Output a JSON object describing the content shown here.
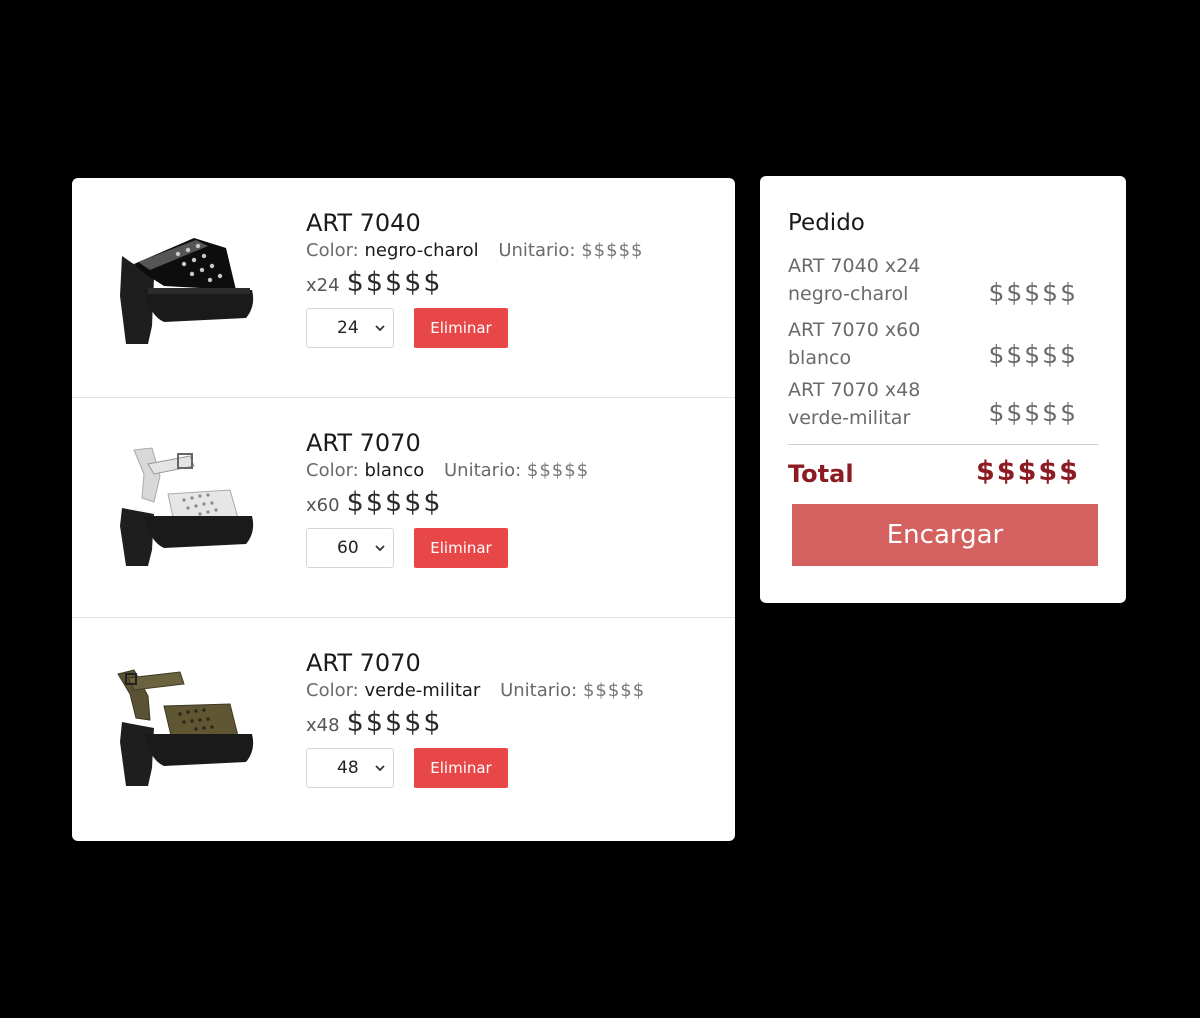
{
  "cart": {
    "items": [
      {
        "art": "ART 7040",
        "color_label": "Color:",
        "color": "negro-charol",
        "unit_label": "Unitario:",
        "unit_price": "$$$$$",
        "qty_text": "x24",
        "subtotal": "$$$$$",
        "qty": "24",
        "remove_label": "Eliminar",
        "image": "shoe-black-patent-studded-platform-sandal"
      },
      {
        "art": "ART 7070",
        "color_label": "Color:",
        "color": "blanco",
        "unit_label": "Unitario:",
        "unit_price": "$$$$$",
        "qty_text": "x60",
        "subtotal": "$$$$$",
        "qty": "60",
        "remove_label": "Eliminar",
        "image": "shoe-white-strap-platform-sandal"
      },
      {
        "art": "ART 7070",
        "color_label": "Color:",
        "color": "verde-militar",
        "unit_label": "Unitario:",
        "unit_price": "$$$$$",
        "qty_text": "x48",
        "subtotal": "$$$$$",
        "qty": "48",
        "remove_label": "Eliminar",
        "image": "shoe-military-green-platform-sandal"
      }
    ]
  },
  "summary": {
    "title": "Pedido",
    "lines": [
      {
        "line1": "ART 7040 x24",
        "line2": "negro-charol",
        "price": "$$$$$"
      },
      {
        "line1": "ART 7070 x60",
        "line2": "blanco",
        "price": "$$$$$"
      },
      {
        "line1": "ART 7070 x48",
        "line2": "verde-militar",
        "price": "$$$$$"
      }
    ],
    "total_label": "Total",
    "total_value": "$$$$$",
    "order_button": "Encargar"
  },
  "colors": {
    "remove_button": "#e84747",
    "order_button": "#d56060",
    "total_text": "#8c1b22",
    "background": "#000000",
    "card": "#ffffff"
  }
}
